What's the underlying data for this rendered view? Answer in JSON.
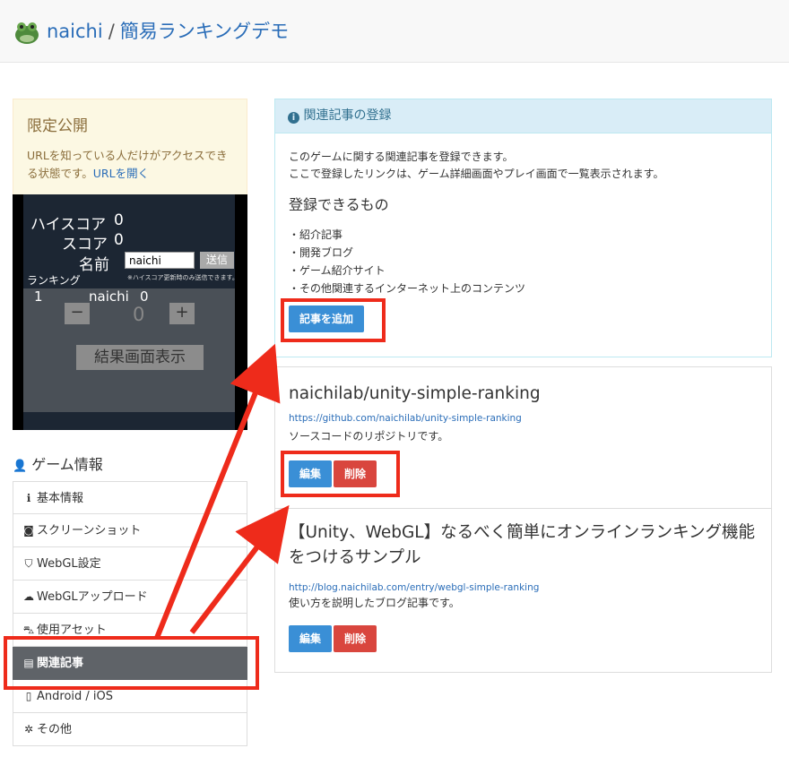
{
  "header": {
    "user": "naichi",
    "separator": "/",
    "project": "簡易ランキングデモ"
  },
  "notice": {
    "title": "限定公開",
    "text": "URLを知っている人だけがアクセスできる状態です。",
    "link": "URLを開く"
  },
  "game": {
    "high_score_label": "ハイスコア",
    "high_score_value": "0",
    "score_label": "スコア",
    "score_value": "0",
    "name_label": "名前",
    "name_value": "naichi",
    "send_label": "送信",
    "ranking_label": "ランキング",
    "note": "※ハイスコア更新時のみ送信できます。",
    "rank_no": "1",
    "rank_name": "naichi",
    "rank_score": "0",
    "minus": "−",
    "plus": "+",
    "stepper_value": "0",
    "result_button": "結果画面表示"
  },
  "sidebar": {
    "section_title": "ゲーム情報",
    "items": [
      {
        "label": "基本情報",
        "icon": "info-icon",
        "glyph": "ℹ"
      },
      {
        "label": "スクリーンショット",
        "icon": "camera-icon",
        "glyph": "◙"
      },
      {
        "label": "WebGL設定",
        "icon": "html5-icon",
        "glyph": "⛉"
      },
      {
        "label": "WebGLアップロード",
        "icon": "cloud-upload-icon",
        "glyph": "☁"
      },
      {
        "label": "使用アセット",
        "icon": "shopping-bag-icon",
        "glyph": "⛍"
      },
      {
        "label": "関連記事",
        "icon": "book-icon",
        "glyph": "▤"
      },
      {
        "label": "Android / iOS",
        "icon": "mobile-icon",
        "glyph": "▯"
      },
      {
        "label": "その他",
        "icon": "gear-icon",
        "glyph": "✲"
      }
    ],
    "active_index": 5
  },
  "related": {
    "panel_title": "関連記事の登録",
    "intro_line1": "このゲームに関する関連記事を登録できます。",
    "intro_line2": "ここで登録したリンクは、ゲーム詳細画面やプレイ画面で一覧表示されます。",
    "allowed_heading": "登録できるもの",
    "allowed": [
      "・紹介記事",
      "・開発ブログ",
      "・ゲーム紹介サイト",
      "・その他関連するインターネット上のコンテンツ"
    ],
    "add_button": "記事を追加"
  },
  "articles": [
    {
      "title": "naichilab/unity-simple-ranking",
      "url": "https://github.com/naichilab/unity-simple-ranking",
      "desc": "ソースコードのリポジトリです。",
      "edit": "編集",
      "delete": "削除"
    },
    {
      "title": "【Unity、WebGL】なるべく簡単にオンラインランキング機能をつけるサンプル",
      "url": "http://blog.naichilab.com/entry/webgl-simple-ranking",
      "desc": "使い方を説明したブログ記事です。",
      "edit": "編集",
      "delete": "削除"
    }
  ],
  "colors": {
    "annotation": "#ee2b1b",
    "primary": "#3a8fd6",
    "danger": "#d9463e"
  }
}
